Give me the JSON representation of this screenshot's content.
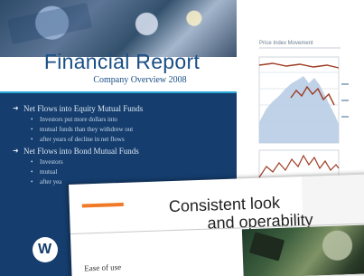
{
  "slide": {
    "title": "Financial Report",
    "subtitle": "Company Overview 2008",
    "bullets": [
      {
        "level": 1,
        "text": "Net Flows into Equity Mutual Funds"
      },
      {
        "level": 2,
        "text": "Investors put more dollars into"
      },
      {
        "level": 2,
        "text": "mutual funds than they withdrew out"
      },
      {
        "level": 2,
        "text": "after years of decline in net flows"
      },
      {
        "level": 1,
        "text": "Net Flows into Bond Mutual Funds"
      },
      {
        "level": 2,
        "text": "Investors"
      },
      {
        "level": 2,
        "text": "mutual"
      },
      {
        "level": 2,
        "text": "after yea"
      }
    ]
  },
  "chart_slide": {
    "heading": "Price Index Movement"
  },
  "card": {
    "title_line1": "Consistent look",
    "title_line2": "and operability",
    "side_text": "Ease of use"
  },
  "colors": {
    "slide_bg": "#153d6d",
    "title_band_bg": "#ffffff",
    "title_text": "#1a4f86",
    "accent_blue": "#2aa9d4",
    "card_accent": "#f07a28",
    "chart_area_fill": "#b8cde6",
    "chart_line": "#9e3c24"
  },
  "icons": {
    "logo": "w-logo-icon",
    "bullet_main": "arrow-bullet-icon",
    "bullet_sub": "dot-bullet-icon"
  }
}
